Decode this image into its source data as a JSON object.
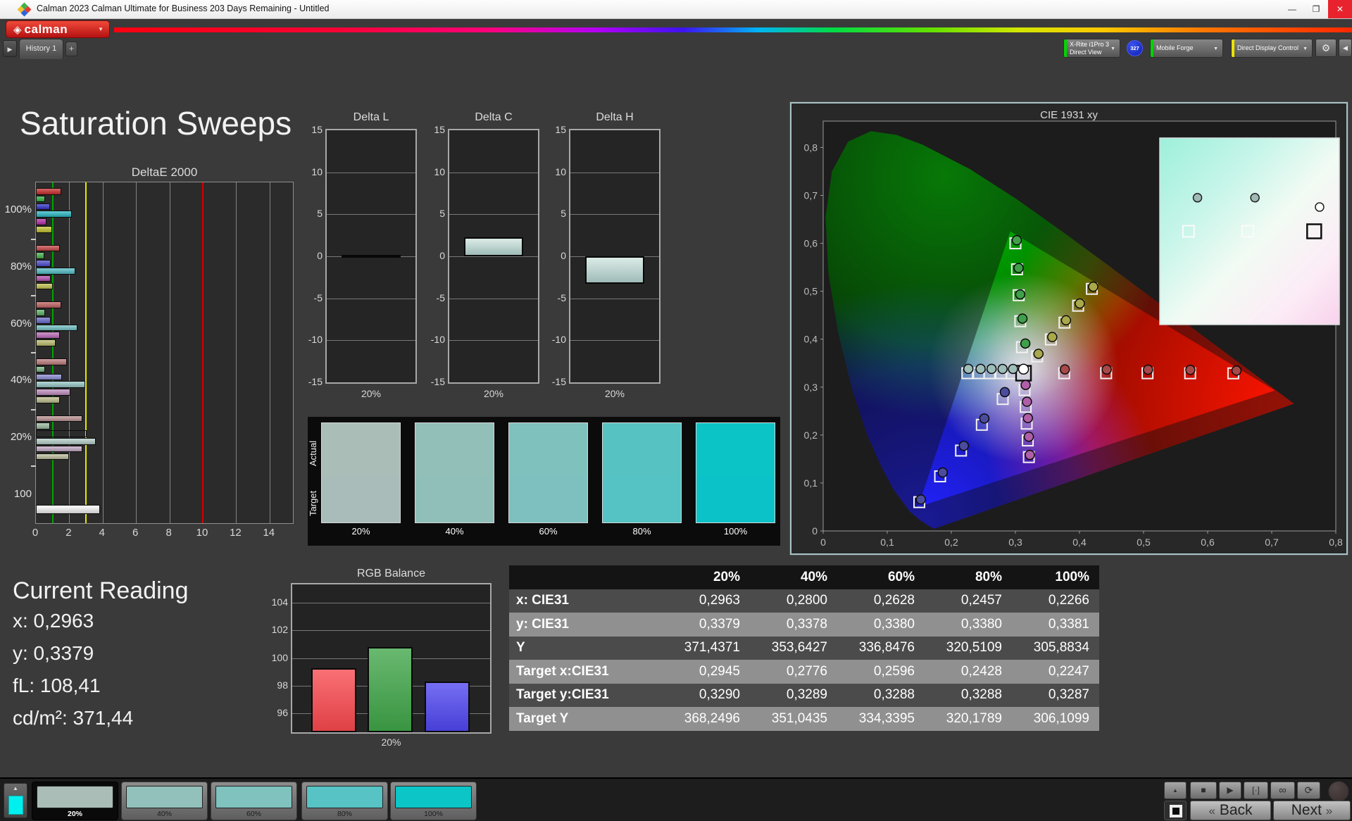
{
  "window": {
    "title": "Calman 2023 Calman Ultimate for Business 203 Days Remaining  - Untitled",
    "controls": {
      "minimize": "—",
      "maximize": "❐",
      "close": "✕"
    }
  },
  "brand": {
    "logo_glyph": "◈",
    "word": "calman",
    "caret": "▼"
  },
  "toolbar": {
    "expander_glyph": "▶",
    "history_tab": "History 1",
    "add_tab": "+",
    "meter": {
      "line1": "X-Rite i1Pro 3",
      "line2": "Direct View",
      "accent": "#00d400",
      "badge": "327",
      "caret": "▼"
    },
    "source": {
      "label": "Mobile Forge",
      "accent": "#00d400",
      "caret": "▼"
    },
    "display_control": {
      "label": "Direct Display Control",
      "accent": "#e8e400",
      "caret": "▼"
    },
    "gear_glyph": "⚙",
    "collapse_glyph": "◀"
  },
  "page": {
    "title": "Saturation Sweeps"
  },
  "chart_data": [
    {
      "type": "bar",
      "title": "DeltaE 2000",
      "orientation": "horizontal",
      "xlabel": "",
      "ylabel": "",
      "xlim": [
        0,
        15.4
      ],
      "x_ticks": [
        0,
        2,
        4,
        6,
        8,
        10,
        12,
        14
      ],
      "reference_lines": [
        {
          "value": 1,
          "color": "#00a400"
        },
        {
          "value": 3,
          "color": "#e6e600"
        },
        {
          "value": 10,
          "color": "#d80000"
        }
      ],
      "series_names": [
        "Red",
        "Green",
        "Blue",
        "Cyan",
        "Magenta",
        "Yellow"
      ],
      "groups": [
        {
          "label": "100%",
          "values": [
            1.5,
            0.55,
            0.85,
            2.15,
            0.65,
            0.95
          ],
          "colors": [
            "#c92b2b",
            "#2eb33e",
            "#3333cc",
            "#2ab9c4",
            "#b52ba8",
            "#c2c22e"
          ]
        },
        {
          "label": "80%",
          "values": [
            1.45,
            0.5,
            0.87,
            2.35,
            0.87,
            1.0
          ],
          "colors": [
            "#c94747",
            "#45b34c",
            "#4d4dcf",
            "#52bec6",
            "#b94fb0",
            "#c2c24f"
          ]
        },
        {
          "label": "60%",
          "values": [
            1.5,
            0.53,
            0.9,
            2.5,
            1.45,
            1.2
          ],
          "colors": [
            "#c26060",
            "#5cb366",
            "#6a6ad1",
            "#74c2c6",
            "#bd6cba",
            "#bdbd6e"
          ]
        },
        {
          "label": "40%",
          "values": [
            1.85,
            0.56,
            1.55,
            2.95,
            2.05,
            1.45
          ],
          "colors": [
            "#bd7b7b",
            "#7bb883",
            "#8c8cd6",
            "#97c8c8",
            "#c18ec0",
            "#bdbd8c"
          ]
        },
        {
          "label": "20%",
          "values": [
            2.8,
            0.85,
            3.05,
            3.6,
            2.8,
            2.0
          ],
          "colors": [
            "#bd9494",
            "#9cbda0",
            "#abaude",
            "#b5cfca",
            "#c4aac6",
            "#c0c0a2"
          ]
        },
        {
          "label": "100",
          "values": [
            3.86
          ],
          "colors": [
            "#f4f4f4"
          ]
        }
      ]
    },
    {
      "type": "bar",
      "title": "Delta L",
      "categories": [
        "20%"
      ],
      "values": [
        0.18
      ],
      "ylim": [
        -15,
        15
      ],
      "y_ticks": [
        15,
        10,
        5,
        0,
        -5,
        -10,
        -15
      ]
    },
    {
      "type": "bar",
      "title": "Delta C",
      "categories": [
        "20%"
      ],
      "values": [
        2.3
      ],
      "ylim": [
        -15,
        15
      ],
      "y_ticks": [
        15,
        10,
        5,
        0,
        -5,
        -10,
        -15
      ]
    },
    {
      "type": "bar",
      "title": "Delta H",
      "categories": [
        "20%"
      ],
      "values": [
        -3.25
      ],
      "ylim": [
        -15,
        15
      ],
      "y_ticks": [
        15,
        10,
        5,
        0,
        -5,
        -10,
        -15
      ]
    },
    {
      "type": "scatter",
      "title": "CIE 1931 xy",
      "xlim": [
        0,
        0.8
      ],
      "ylim": [
        0,
        0.855
      ],
      "x_ticks": [
        "0",
        "0,1",
        "0,2",
        "0,3",
        "0,4",
        "0,5",
        "0,6",
        "0,7",
        "0,8"
      ],
      "y_ticks": [
        "0",
        "0,1",
        "0,2",
        "0,3",
        "0,4",
        "0,5",
        "0,6",
        "0,7",
        "0,8"
      ],
      "white_point": {
        "target": [
          0.3127,
          0.329
        ],
        "measured": [
          0.3127,
          0.3375
        ]
      },
      "series": [
        {
          "name": "red",
          "color": "#a84848",
          "targets": [
            [
              0.3761,
              0.329
            ],
            [
              0.4416,
              0.329
            ],
            [
              0.5062,
              0.3289
            ],
            [
              0.5727,
              0.3288
            ],
            [
              0.64,
              0.3287
            ]
          ],
          "measured": [
            [
              0.3772,
              0.337
            ],
            [
              0.4425,
              0.3368
            ],
            [
              0.507,
              0.3365
            ],
            [
              0.573,
              0.336
            ],
            [
              0.645,
              0.3345
            ]
          ]
        },
        {
          "name": "green",
          "color": "#3fa04a",
          "targets": [
            [
              0.3102,
              0.3833
            ],
            [
              0.3076,
              0.4375
            ],
            [
              0.3051,
              0.4917
            ],
            [
              0.3025,
              0.5458
            ],
            [
              0.3,
              0.6
            ]
          ],
          "measured": [
            [
              0.3155,
              0.391
            ],
            [
              0.311,
              0.443
            ],
            [
              0.3075,
              0.4935
            ],
            [
              0.305,
              0.5485
            ],
            [
              0.3022,
              0.6065
            ]
          ]
        },
        {
          "name": "blue",
          "color": "#4c4c9e",
          "targets": [
            [
              0.2802,
              0.2752
            ],
            [
              0.2476,
              0.2214
            ],
            [
              0.2151,
              0.1676
            ],
            [
              0.1825,
              0.1138
            ],
            [
              0.15,
              0.06
            ]
          ],
          "measured": [
            [
              0.2835,
              0.2895
            ],
            [
              0.2515,
              0.2345
            ],
            [
              0.2195,
              0.1775
            ],
            [
              0.1865,
              0.122
            ],
            [
              0.1525,
              0.0655
            ]
          ]
        },
        {
          "name": "cyan",
          "color": "#9fbdb9",
          "targets": [
            [
              0.2945,
              0.329
            ],
            [
              0.2776,
              0.329
            ],
            [
              0.2596,
              0.329
            ],
            [
              0.2428,
              0.329
            ],
            [
              0.225,
              0.329
            ]
          ],
          "measured": [
            [
              0.2963,
              0.3379
            ],
            [
              0.28,
              0.3378
            ],
            [
              0.2628,
              0.338
            ],
            [
              0.2457,
              0.338
            ],
            [
              0.2266,
              0.3381
            ]
          ]
        },
        {
          "name": "magenta",
          "color": "#b05ea8",
          "targets": [
            [
              0.3143,
              0.2939
            ],
            [
              0.316,
              0.2588
            ],
            [
              0.3176,
              0.2238
            ],
            [
              0.3193,
              0.1887
            ],
            [
              0.321,
              0.154
            ]
          ],
          "measured": [
            [
              0.316,
              0.3045
            ],
            [
              0.318,
              0.2695
            ],
            [
              0.3195,
              0.2355
            ],
            [
              0.321,
              0.1965
            ],
            [
              0.3225,
              0.1585
            ]
          ]
        },
        {
          "name": "yellow",
          "color": "#a9a94b",
          "targets": [
            [
              0.334,
              0.3642
            ],
            [
              0.3553,
              0.3994
            ],
            [
              0.3766,
              0.4346
            ],
            [
              0.3979,
              0.4698
            ],
            [
              0.4193,
              0.505
            ]
          ],
          "measured": [
            [
              0.336,
              0.3695
            ],
            [
              0.3575,
              0.4045
            ],
            [
              0.379,
              0.4395
            ],
            [
              0.4005,
              0.4745
            ],
            [
              0.4215,
              0.5095
            ]
          ]
        }
      ],
      "inset": {
        "circles_gray": [
          [
            0.21,
            0.32
          ],
          [
            0.53,
            0.32
          ]
        ],
        "circle_open": [
          0.89,
          0.37
        ],
        "squares_white": [
          [
            0.16,
            0.5
          ],
          [
            0.49,
            0.5
          ]
        ],
        "square_black": [
          0.86,
          0.5
        ]
      }
    },
    {
      "type": "bar",
      "title": "RGB Balance",
      "categories": [
        "Red",
        "Green",
        "Blue"
      ],
      "values": [
        99.25,
        100.8,
        98.3
      ],
      "colors": [
        "#f8484e",
        "#3fa548",
        "#4f46ef"
      ],
      "ylim": [
        94.6,
        105.35
      ],
      "y_ticks": [
        104,
        102,
        100,
        98,
        96
      ],
      "group_label": "20%"
    }
  ],
  "swatch_strip": {
    "row_labels": [
      "Actual",
      "Target"
    ],
    "swatches": [
      {
        "label": "20%",
        "actual": "#aabdb6",
        "target": "#a9bcb9"
      },
      {
        "label": "40%",
        "actual": "#92bfb8",
        "target": "#90bfba"
      },
      {
        "label": "60%",
        "actual": "#7ec1bd",
        "target": "#7dc0bf"
      },
      {
        "label": "80%",
        "actual": "#56c2c2",
        "target": "#55c2c4"
      },
      {
        "label": "100%",
        "actual": "#0bc4c5",
        "target": "#0cc2c9"
      }
    ]
  },
  "current_reading": {
    "heading": "Current Reading",
    "lines": [
      {
        "label": "x:",
        "value": "0,2963"
      },
      {
        "label": "y:",
        "value": "0,3379"
      },
      {
        "label": "fL:",
        "value": "108,41"
      },
      {
        "label": "cd/m²:",
        "value": "371,44"
      }
    ]
  },
  "table": {
    "columns": [
      "",
      "20%",
      "40%",
      "60%",
      "80%",
      "100%"
    ],
    "rows": [
      {
        "label": "x: CIE31",
        "values": [
          "0,2963",
          "0,2800",
          "0,2628",
          "0,2457",
          "0,2266"
        ]
      },
      {
        "label": "y: CIE31",
        "values": [
          "0,3379",
          "0,3378",
          "0,3380",
          "0,3380",
          "0,3381"
        ]
      },
      {
        "label": "Y",
        "values": [
          "371,4371",
          "353,6427",
          "336,8476",
          "320,5109",
          "305,8834"
        ]
      },
      {
        "label": "Target x:CIE31",
        "values": [
          "0,2945",
          "0,2776",
          "0,2596",
          "0,2428",
          "0,2247"
        ]
      },
      {
        "label": "Target y:CIE31",
        "values": [
          "0,3290",
          "0,3289",
          "0,3288",
          "0,3288",
          "0,3287"
        ]
      },
      {
        "label": "Target Y",
        "values": [
          "368,2496",
          "351,0435",
          "334,3395",
          "320,1789",
          "306,1099"
        ]
      }
    ]
  },
  "bottom_bar": {
    "mini_swatch_color": "#00efef",
    "up_glyph": "▲",
    "patches": [
      {
        "label": "20%",
        "color": "#aabdb6",
        "selected": true
      },
      {
        "label": "40%",
        "color": "#92c0ba",
        "selected": false
      },
      {
        "label": "60%",
        "color": "#7fc2be",
        "selected": false
      },
      {
        "label": "80%",
        "color": "#57c3c4",
        "selected": false
      },
      {
        "label": "100%",
        "color": "#0bc5c6",
        "selected": false
      }
    ],
    "transport": {
      "stop": "■",
      "play": "▶",
      "single": "[·]",
      "continuous": "∞",
      "refresh": "⟳"
    },
    "back_label": "Back",
    "next_label": "Next",
    "back_glyph": "«",
    "next_glyph": "»"
  }
}
